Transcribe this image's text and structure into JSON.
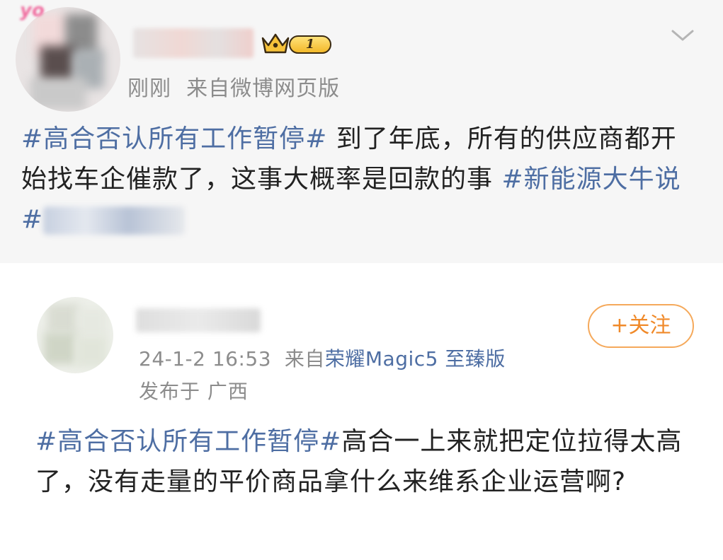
{
  "post1": {
    "time": "刚刚",
    "source": "来自微博网页版",
    "vip_level": "1",
    "text_parts": {
      "tag1": "#高合否认所有工作暂停#",
      "body": " 到了年底，所有的供应商都开始找车企催款了，这事大概率是回款的事 ",
      "tag2": "#新能源大牛说#"
    }
  },
  "post2": {
    "time": "24-1-2 16:53",
    "source_prefix": "来自",
    "source": "荣耀Magic5 至臻版",
    "location": "发布于 广西",
    "follow_label": "+关注",
    "text_parts": {
      "tag": "#高合否认所有工作暂停#",
      "body": "高合一上来就把定位拉得太高了，没有走量的平价商品拿什么来维系企业运营啊?"
    }
  },
  "icons": {
    "chevron": "chevron-down-icon",
    "crown": "crown-icon"
  },
  "colors": {
    "topic_link": "#4e6ea3",
    "follow_accent": "#f08a2a",
    "meta_gray": "#8c8c8c"
  }
}
